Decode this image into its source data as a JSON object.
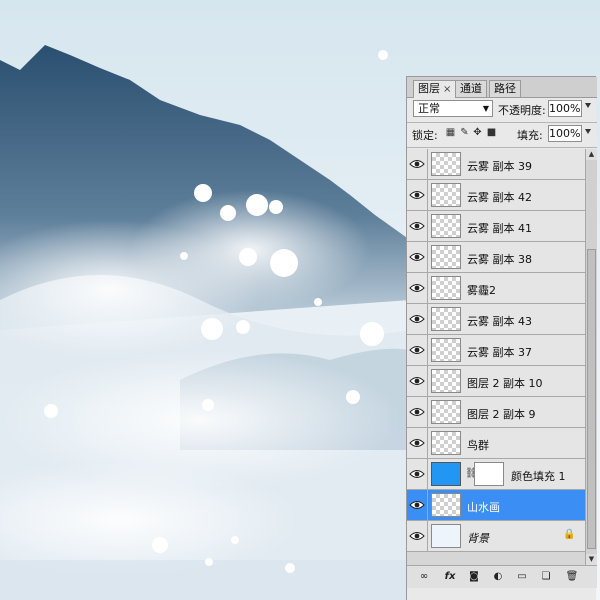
{
  "panel": {
    "tabs": [
      {
        "label": "图层",
        "close": "×"
      },
      {
        "label": "通道"
      },
      {
        "label": "路径"
      }
    ],
    "blend_mode": "正常",
    "opacity_label": "不透明度:",
    "opacity_value": "100%",
    "lock_label": "锁定:",
    "fill_label": "填充:",
    "fill_value": "100%"
  },
  "layers": [
    {
      "name": "云雾 副本 39",
      "thumb": "transparent",
      "visible": true
    },
    {
      "name": "云雾 副本 42",
      "thumb": "transparent",
      "visible": true
    },
    {
      "name": "云雾 副本 41",
      "thumb": "transparent",
      "visible": true
    },
    {
      "name": "云雾 副本 38",
      "thumb": "transparent",
      "visible": true
    },
    {
      "name": "雾霾2",
      "thumb": "transparent",
      "visible": true
    },
    {
      "name": "云雾 副本 43",
      "thumb": "transparent",
      "visible": true
    },
    {
      "name": "云雾 副本 37",
      "thumb": "transparent",
      "visible": true
    },
    {
      "name": "图层 2 副本 10",
      "thumb": "transparent",
      "visible": true
    },
    {
      "name": "图层 2 副本 9",
      "thumb": "transparent",
      "visible": true
    },
    {
      "name": "鸟群",
      "thumb": "transparent",
      "visible": true
    },
    {
      "name": "颜色填充 1",
      "thumb": "blue",
      "visible": true,
      "has_mask": true
    },
    {
      "name": "山水画",
      "thumb": "transparent",
      "visible": true,
      "selected": true
    },
    {
      "name": "背景",
      "thumb": "pale",
      "visible": true,
      "italic": true,
      "locked": true
    }
  ],
  "colors": {
    "selection": "#3b8ef4",
    "fill_color": "#2196f3",
    "mountain": "#2f5272"
  },
  "icons": [
    "eye-icon",
    "link-icon",
    "lock-icon",
    "fx-icon",
    "mask-icon",
    "adjustment-icon",
    "folder-icon",
    "new-layer-icon",
    "trash-icon"
  ]
}
